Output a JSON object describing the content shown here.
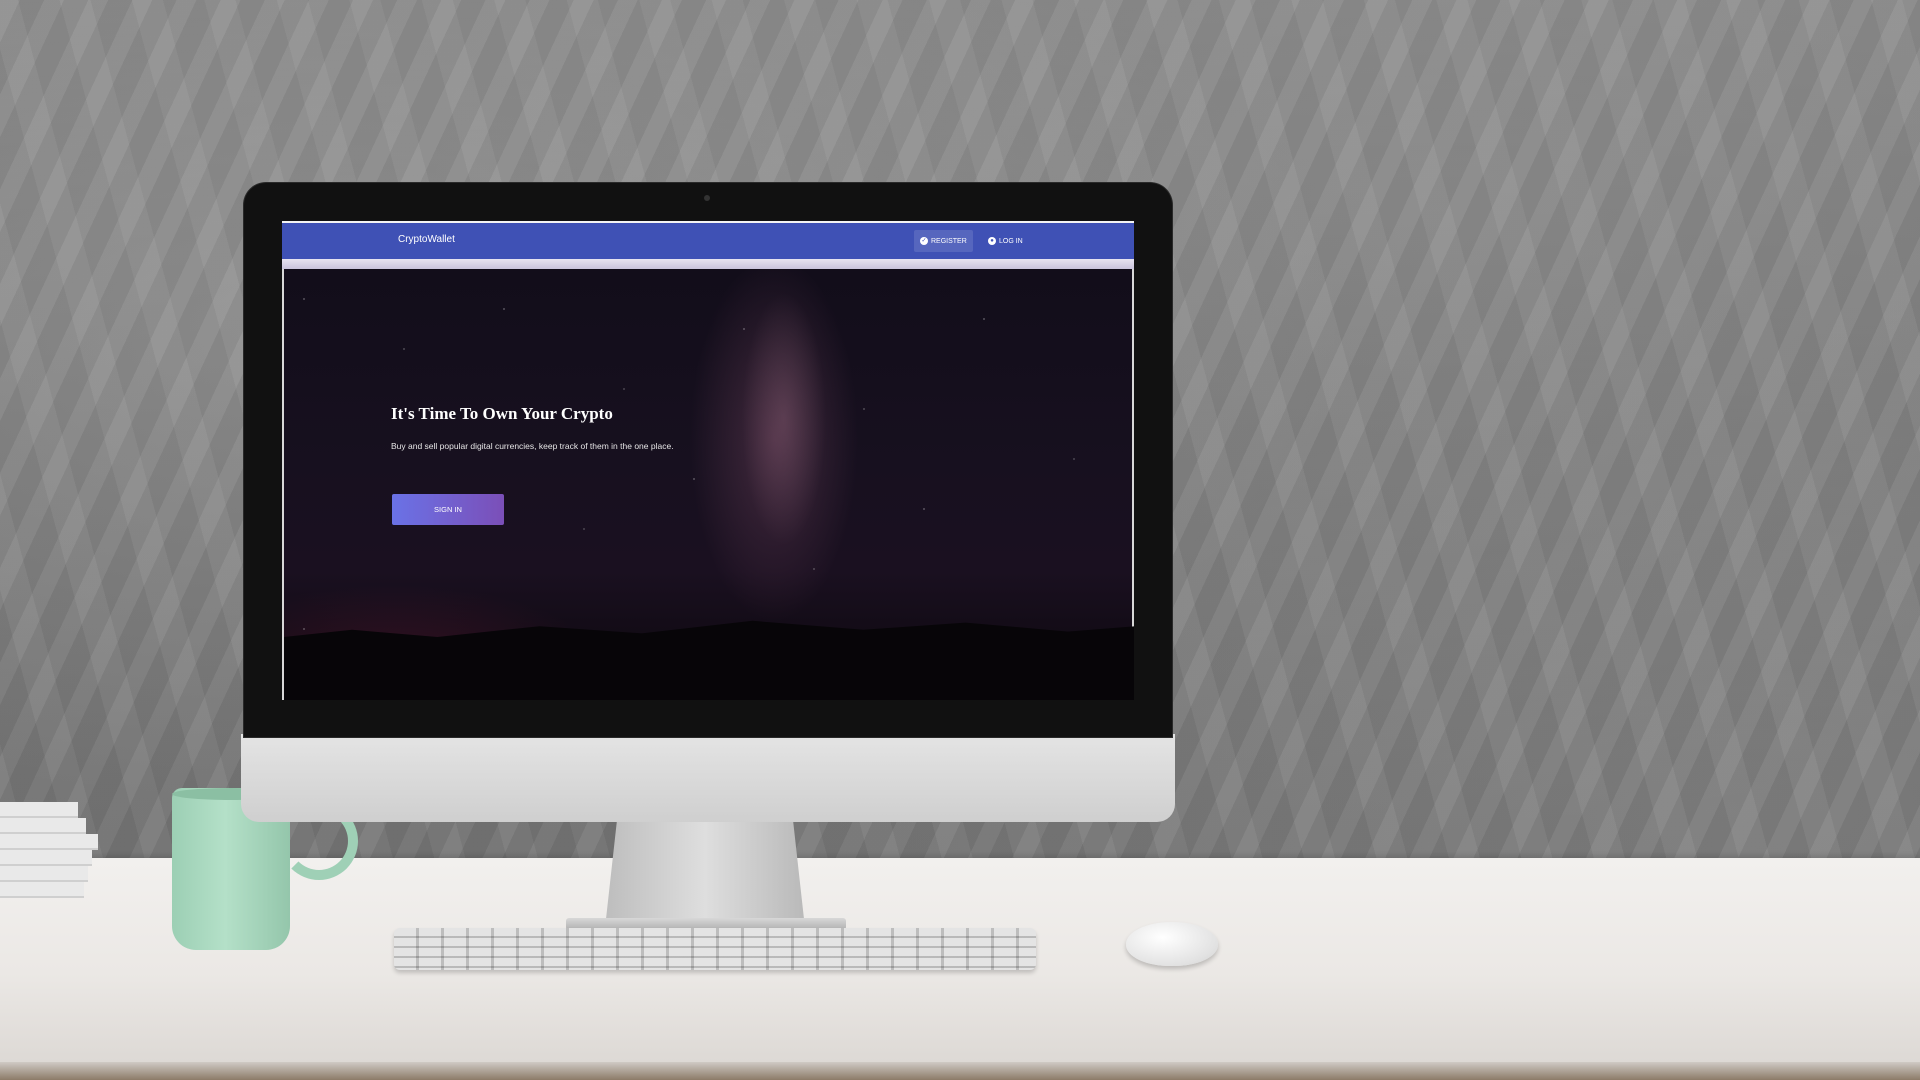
{
  "app": {
    "brand": "CryptoWallet"
  },
  "nav": {
    "register_label": "REGISTER",
    "login_label": "LOG IN",
    "register_icon": "check-circle-icon",
    "login_icon": "account-circle-icon"
  },
  "hero": {
    "title": "It's Time To Own Your Crypto",
    "subtitle": "Buy and sell popular digital currencies, keep track of them in the one place.",
    "signin_label": "SIGN IN"
  },
  "colors": {
    "navbar": "#3f51b5",
    "signin_gradient_start": "#6a72e6",
    "signin_gradient_end": "#7b4fb8"
  }
}
